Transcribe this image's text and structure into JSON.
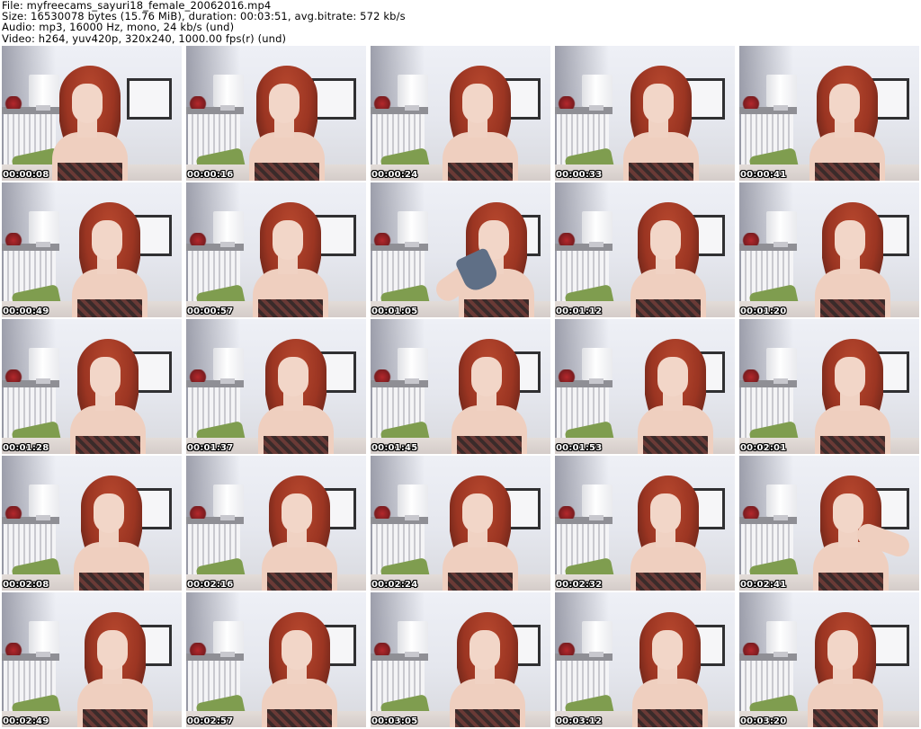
{
  "header": {
    "file_line": "File: myfreecams_sayuri18_female_20062016.mp4",
    "size_line": "Size: 16530078 bytes (15.76 MiB), duration: 00:03:51, avg.bitrate: 572 kb/s",
    "audio_line": "Audio: mp3, 16000 Hz, mono, 24 kb/s (und)",
    "video_line": "Video: h264, yuv420p, 320x240, 1000.00 fps(r) (und)"
  },
  "thumbnails": [
    {
      "time": "00:00:08"
    },
    {
      "time": "00:00:16"
    },
    {
      "time": "00:00:24"
    },
    {
      "time": "00:00:33"
    },
    {
      "time": "00:00:41"
    },
    {
      "time": "00:00:49"
    },
    {
      "time": "00:00:57"
    },
    {
      "time": "00:01:05"
    },
    {
      "time": "00:01:12"
    },
    {
      "time": "00:01:20"
    },
    {
      "time": "00:01:28"
    },
    {
      "time": "00:01:37"
    },
    {
      "time": "00:01:45"
    },
    {
      "time": "00:01:53"
    },
    {
      "time": "00:02:01"
    },
    {
      "time": "00:02:08"
    },
    {
      "time": "00:02:16"
    },
    {
      "time": "00:02:24"
    },
    {
      "time": "00:02:32"
    },
    {
      "time": "00:02:41"
    },
    {
      "time": "00:02:49"
    },
    {
      "time": "00:02:57"
    },
    {
      "time": "00:03:05"
    },
    {
      "time": "00:03:12"
    },
    {
      "time": "00:03:20"
    }
  ]
}
